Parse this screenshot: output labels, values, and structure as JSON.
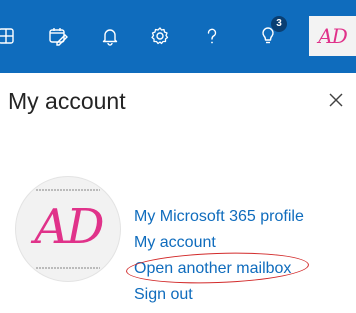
{
  "topbar": {
    "background": "#0f6cbd",
    "icons": [
      {
        "name": "teams-chat-icon"
      },
      {
        "name": "calendar-edit-icon"
      },
      {
        "name": "bell-icon"
      },
      {
        "name": "gear-icon"
      },
      {
        "name": "help-icon"
      },
      {
        "name": "lightbulb-icon",
        "badge": "3"
      }
    ],
    "avatar_initials": "AD"
  },
  "panel": {
    "title": "My account",
    "close_glyph": "✕",
    "avatar_initials": "AD",
    "accent_color": "#e0328a",
    "links": [
      {
        "label": "My Microsoft 365 profile"
      },
      {
        "label": "My account"
      },
      {
        "label": "Open another mailbox"
      },
      {
        "label": "Sign out"
      }
    ],
    "link_color": "#0f6cbd",
    "highlight_color": "#d22a2a"
  }
}
